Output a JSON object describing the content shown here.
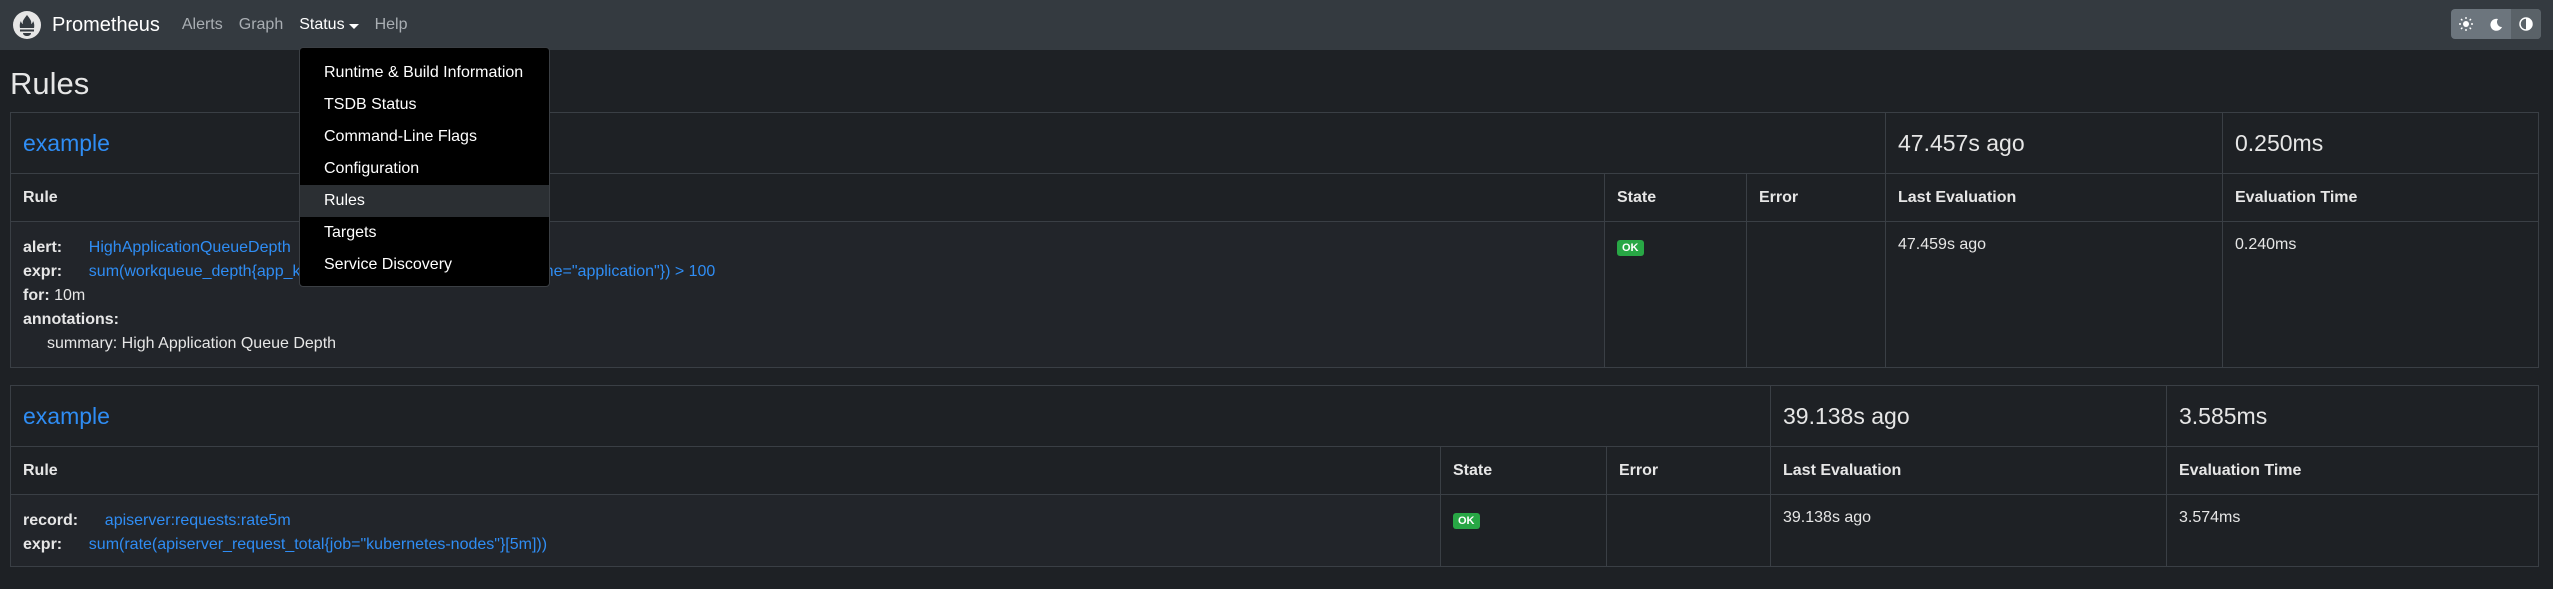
{
  "navbar": {
    "brand": "Prometheus",
    "links": [
      "Alerts",
      "Graph",
      "Status",
      "Help"
    ],
    "theme_icons": [
      "sun-icon",
      "moon-icon",
      "half-circle-icon"
    ]
  },
  "status_menu": {
    "items": [
      "Runtime & Build Information",
      "TSDB Status",
      "Command-Line Flags",
      "Configuration",
      "Rules",
      "Targets",
      "Service Discovery"
    ],
    "active": "Rules"
  },
  "page_title": "Rules",
  "columns": {
    "rule": "Rule",
    "state": "State",
    "error": "Error",
    "last_eval": "Last Evaluation",
    "eval_time": "Evaluation Time"
  },
  "groups": [
    {
      "name": "example",
      "last_eval": "47.457s ago",
      "eval_time": "0.250ms",
      "rule": {
        "alert_label": "alert:",
        "alert_name": "HighApplicationQueueDepth",
        "expr_label": "expr:",
        "expr_visible_start": "sum(workqueue_depth{app_k",
        "expr_visible_end": "name=\"application\"}) > 100",
        "for_label": "for:",
        "for_value": "10m",
        "annotations_label": "annotations:",
        "summary": "summary: High Application Queue Depth",
        "state": "OK",
        "error": "",
        "last_eval": "47.459s ago",
        "eval_time": "0.240ms"
      }
    },
    {
      "name": "example",
      "last_eval": "39.138s ago",
      "eval_time": "3.585ms",
      "rule": {
        "record_label": "record:",
        "record_name": "apiserver:requests:rate5m",
        "expr_label": "expr:",
        "expr": "sum(rate(apiserver_request_total{job=\"kubernetes-nodes\"}[5m]))",
        "state": "OK",
        "error": "",
        "last_eval": "39.138s ago",
        "eval_time": "3.574ms"
      }
    }
  ]
}
